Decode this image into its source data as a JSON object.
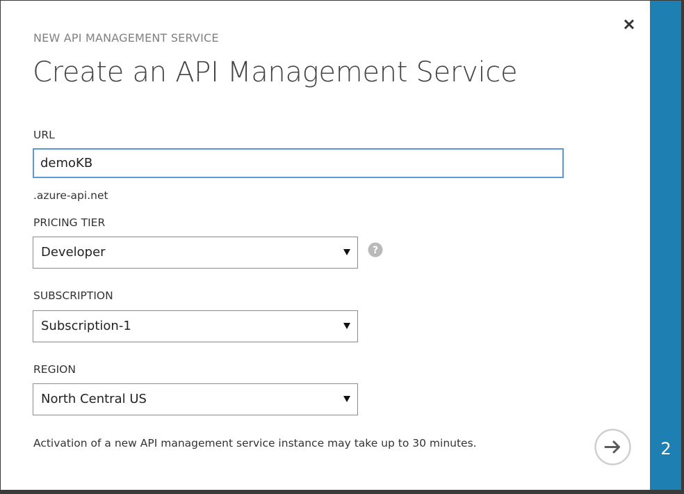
{
  "dialog": {
    "subtitle": "NEW API MANAGEMENT SERVICE",
    "title": "Create an API Management Service",
    "step_number": "2",
    "accent_color": "#1e7fb3"
  },
  "form": {
    "url": {
      "label": "URL",
      "value": "demoKB",
      "suffix": ".azure-api.net"
    },
    "pricing_tier": {
      "label": "PRICING TIER",
      "selected": "Developer"
    },
    "subscription": {
      "label": "SUBSCRIPTION",
      "selected": "Subscription-1"
    },
    "region": {
      "label": "REGION",
      "selected": "North Central US"
    }
  },
  "footer": {
    "note": "Activation of a new API management service instance may take up to 30 minutes."
  },
  "icons": {
    "close": "close-icon",
    "help": "help-icon",
    "next": "arrow-right-icon",
    "dropdown": "dropdown-arrow-icon"
  }
}
